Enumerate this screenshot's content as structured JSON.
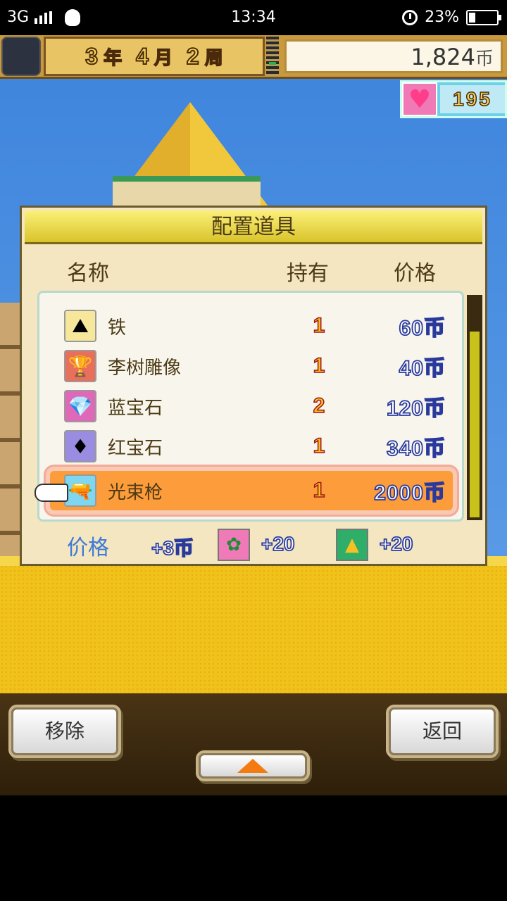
{
  "status_bar": {
    "network": "3G",
    "time": "13:34",
    "battery": "23%"
  },
  "hud": {
    "year_num": "3",
    "year_unit": "年",
    "month_num": "4",
    "month_unit": "月",
    "week_num": "2",
    "week_unit": "周",
    "coins_value": "1,824",
    "coins_unit": "币",
    "hearts": "195"
  },
  "dialog": {
    "title": "配置道具",
    "col_name": "名称",
    "col_owned": "持有",
    "col_price": "价格",
    "items": [
      {
        "name": "铁",
        "owned": "1",
        "price": "60币",
        "icon": "iron-ore-icon",
        "glyph": "⛰",
        "bg": "#f6e79a"
      },
      {
        "name": "李树雕像",
        "owned": "1",
        "price": "40币",
        "icon": "statue-icon",
        "glyph": "🏆",
        "bg": "#e8705a"
      },
      {
        "name": "蓝宝石",
        "owned": "2",
        "price": "120币",
        "icon": "sapphire-icon",
        "glyph": "💎",
        "bg": "#e068b8"
      },
      {
        "name": "红宝石",
        "owned": "1",
        "price": "340币",
        "icon": "ruby-icon",
        "glyph": "♦",
        "bg": "#9a8ce0"
      },
      {
        "name": "光束枪",
        "owned": "1",
        "price": "2000币",
        "icon": "beam-gun-icon",
        "glyph": "🔫",
        "bg": "#7fd6f0"
      }
    ],
    "selected_index": 4,
    "footer": {
      "label": "价格",
      "price_bonus": "+3币",
      "flower_bonus": "+20",
      "pyramid_bonus": "+20"
    }
  },
  "buttons": {
    "remove": "移除",
    "back": "返回"
  },
  "colors": {
    "sky": "#4f8fe0",
    "sand": "#f0c21a",
    "dialog_bg": "#f3e6c0",
    "selected_row": "#fd9c3a"
  }
}
